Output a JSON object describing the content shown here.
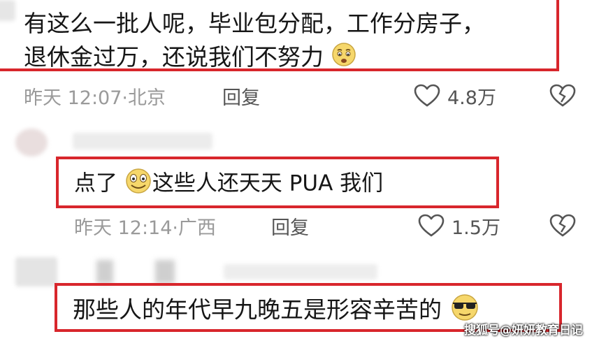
{
  "comments": [
    {
      "line1": "有这么一批人呢，毕业包分配，工作分房子，",
      "line2": "退休金过万，还说我们不努力",
      "time": "昨天 12:07",
      "location": "北京",
      "reply_label": "回复",
      "likes": "4.8万"
    },
    {
      "text_a": "点了",
      "text_b": "这些人还天天 PUA 我们",
      "time": "昨天 12:14",
      "location": "广西",
      "reply_label": "回复",
      "likes": "1.5万"
    },
    {
      "text": "那些人的年代早九晚五是形容辛苦的"
    }
  ],
  "meta_separator": "·",
  "watermark": "搜狐号@妍妍教育日记",
  "colors": {
    "highlight": "#d8262c",
    "meta": "#9a9a9a"
  }
}
